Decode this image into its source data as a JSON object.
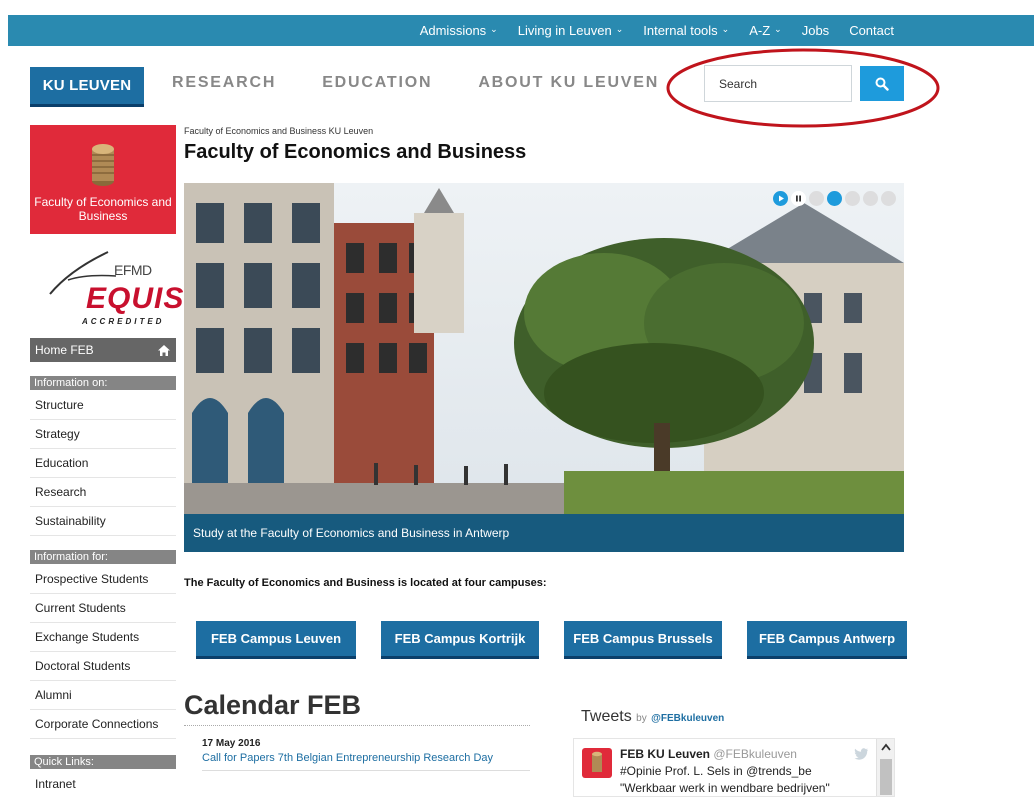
{
  "topnav": {
    "items": [
      {
        "label": "Admissions",
        "dropdown": true
      },
      {
        "label": "Living in Leuven",
        "dropdown": true
      },
      {
        "label": "Internal tools",
        "dropdown": true
      },
      {
        "label": "A-Z",
        "dropdown": true
      },
      {
        "label": "Jobs",
        "dropdown": false
      },
      {
        "label": "Contact",
        "dropdown": false
      }
    ]
  },
  "logo": {
    "text": "KU LEUVEN"
  },
  "mainnav": {
    "items": [
      {
        "label": "RESEARCH"
      },
      {
        "label": "EDUCATION"
      },
      {
        "label": "ABOUT KU LEUVEN"
      }
    ]
  },
  "search": {
    "placeholder": "Search",
    "button_icon": "search-icon"
  },
  "sidebar": {
    "faculty_logo_text": "Faculty of Economics and Business",
    "efmd": "EFMD",
    "equis": "EQUIS",
    "accredited": "ACCREDITED",
    "home": {
      "label": "Home FEB",
      "icon": "home-icon"
    },
    "sections": [
      {
        "heading": "Information on:",
        "items": [
          "Structure",
          "Strategy",
          "Education",
          "Research",
          "Sustainability"
        ]
      },
      {
        "heading": "Information for:",
        "items": [
          "Prospective Students",
          "Current Students",
          "Exchange Students",
          "Doctoral Students",
          "Alumni",
          "Corporate Connections"
        ]
      },
      {
        "heading": "Quick Links:",
        "items": [
          "Intranet"
        ]
      }
    ]
  },
  "main": {
    "breadcrumb": "Faculty of Economics and Business KU Leuven",
    "title": "Faculty of Economics and Business",
    "hero": {
      "caption": "Study at the Faculty of Economics and Business in Antwerp",
      "slides_count": 5,
      "active_slide": 2
    },
    "campus_intro": "The Faculty of Economics and Business is located at four campuses:",
    "campuses": [
      "FEB Campus Leuven",
      "FEB Campus Kortrijk",
      "FEB Campus Brussels",
      "FEB Campus Antwerp"
    ],
    "calendar": {
      "title": "Calendar FEB",
      "events": [
        {
          "date": "17 May 2016",
          "title": "Call for Papers 7th Belgian Entrepreneurship Research Day"
        }
      ]
    },
    "tweets": {
      "title": "Tweets",
      "by": "by",
      "handle": "@FEBkuleuven",
      "items": [
        {
          "name": "FEB KU Leuven",
          "handle": "@FEBkuleuven",
          "line1": "#Opinie Prof. L. Sels in @trends_be",
          "line2": "\"Werkbaar werk in wendbare bedrijven\""
        }
      ]
    }
  },
  "colors": {
    "topbar": "#2a8ab0",
    "brand_blue": "#1d6ea2",
    "search_button": "#1e9bdc",
    "faculty_red": "#e02a3a",
    "annotation_ellipse": "#c0141c"
  }
}
